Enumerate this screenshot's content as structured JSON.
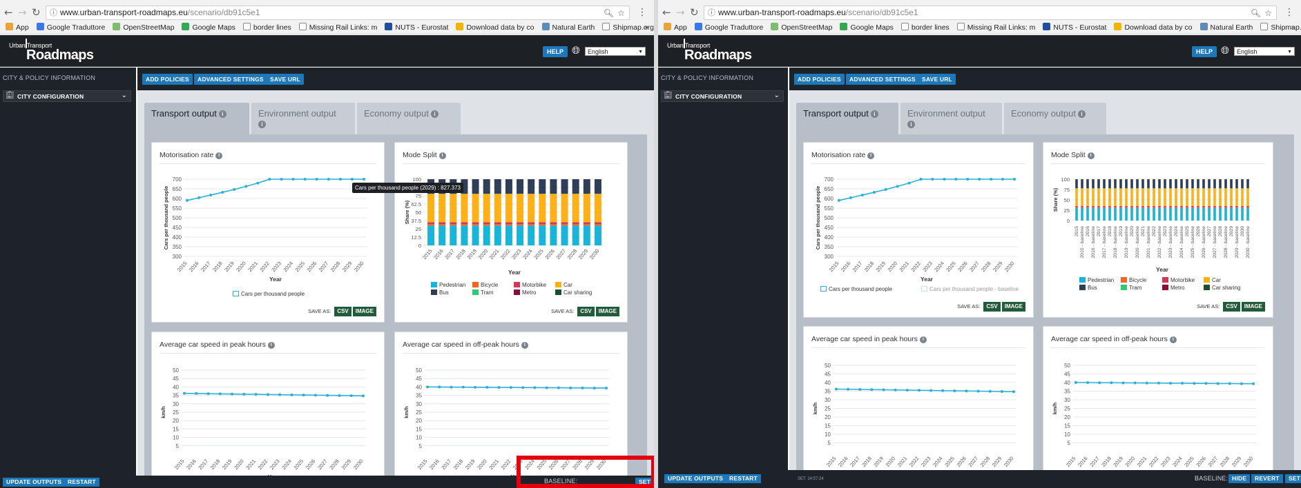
{
  "browser": {
    "url_host": "www.urban-transport-roadmaps.eu",
    "url_path": "/scenario/db91c5e1",
    "bookmarks": [
      {
        "label": "App",
        "color": "#e8a33a"
      },
      {
        "label": "Google Traduttore",
        "color": "#3b78e7"
      },
      {
        "label": "OpenStreetMap",
        "color": "#7ebc6f"
      },
      {
        "label": "Google Maps",
        "color": "#34a853"
      },
      {
        "label": "border lines",
        "color": "#ffffff"
      },
      {
        "label": "Missing Rail Links: m",
        "color": "#ffffff"
      },
      {
        "label": "NUTS - Eurostat",
        "color": "#1f4e9e"
      },
      {
        "label": "Download data by co",
        "color": "#f4b400"
      },
      {
        "label": "Natural Earth",
        "color": "#5b8db8"
      },
      {
        "label": "Shipmap.org | Visual",
        "color": "#ffffff"
      }
    ]
  },
  "app": {
    "logo_small": "Urban Transport",
    "logo_big": "Roadmaps",
    "help": "HELP",
    "language": "English"
  },
  "sidebar": {
    "title": "CITY & POLICY INFORMATION",
    "city_config": "CITY CONFIGURATION"
  },
  "toolbar": {
    "add_policies": "ADD POLICIES",
    "advanced_settings": "ADVANCED SETTINGS",
    "save_url": "SAVE URL"
  },
  "tabs": [
    {
      "label": "Transport output"
    },
    {
      "label": "Environment output"
    },
    {
      "label": "Economy output"
    }
  ],
  "cards": {
    "motorisation": "Motorisation rate",
    "mode_split": "Mode Split",
    "peak": "Average car speed in peak hours",
    "offpeak": "Average car speed in off-peak hours"
  },
  "save": {
    "label": "SAVE AS:",
    "csv": "CSV",
    "image": "IMAGE"
  },
  "tooltip": "Cars per thousand people (2029) : 827.373",
  "bottom": {
    "update": "UPDATE OUTPUTS",
    "restart": "RESTART",
    "baseline": "BASELINE:",
    "set": "SET",
    "hide": "HIDE",
    "revert": "REVERT",
    "stamp": "SET: 14:57:24"
  },
  "colors": {
    "series": "#2ab0d8",
    "pedestrian": "#19b4d8",
    "bicycle": "#f26522",
    "motorbike": "#d2375a",
    "car": "#fbb117",
    "bus": "#2f3e59",
    "tram": "#2ecc71",
    "metro": "#8b0a3c",
    "car_sharing": "#1b4d2e"
  },
  "chart_data": [
    {
      "id": "motorisation",
      "type": "line",
      "title": "Motorisation rate",
      "xlabel": "Year",
      "ylabel": "Cars per thousand people",
      "x": [
        "2015",
        "2016",
        "2017",
        "2018",
        "2019",
        "2020",
        "2021",
        "2022",
        "2023",
        "2024",
        "2025",
        "2026",
        "2027",
        "2028",
        "2029",
        "2030"
      ],
      "yticks": [
        300,
        350,
        400,
        450,
        500,
        550,
        600,
        650,
        700
      ],
      "ylim": [
        300,
        700
      ],
      "series": [
        {
          "name": "Cars per thousand people",
          "values": [
            590,
            604,
            618,
            632,
            647,
            663,
            680,
            700,
            700,
            700,
            700,
            700,
            700,
            700,
            700,
            700
          ]
        }
      ],
      "baseline_series_name": "Cars per thousand people - baseline"
    },
    {
      "id": "mode_split",
      "type": "bar",
      "stacked": true,
      "title": "Mode Split",
      "xlabel": "Year",
      "ylabel": "Share (%)",
      "x": [
        "2015",
        "2016",
        "2017",
        "2018",
        "2019",
        "2020",
        "2021",
        "2022",
        "2023",
        "2024",
        "2025",
        "2026",
        "2027",
        "2028",
        "2029",
        "2030"
      ],
      "yticks_left": [
        "0",
        "12.5",
        "25",
        "37.5",
        "50",
        "62.5",
        "75",
        "87.5",
        "100"
      ],
      "yticks_right": [
        "0",
        "25",
        "50",
        "75",
        "100"
      ],
      "right_x_labels": [
        "2015",
        "2015 - baseline",
        "2016",
        "2016 - baseline",
        "2017",
        "2017 - baseline",
        "2018",
        "2018 - baseline",
        "2019",
        "2019 - baseline",
        "2020",
        "2020 - baseline",
        "2021",
        "2021 - baseline",
        "2022",
        "2022 - baseline",
        "2023",
        "2023 - baseline",
        "2024",
        "2024 - baseline",
        "2025",
        "2025 - baseline",
        "2026",
        "2026 - baseline",
        "2027",
        "2027 - baseline",
        "2028",
        "2028 - baseline",
        "2029",
        "2029 - baseline",
        "2030",
        "2030 - baseline"
      ],
      "series": [
        {
          "name": "Pedestrian",
          "value": 30
        },
        {
          "name": "Bus",
          "value": 0
        },
        {
          "name": "Bicycle",
          "value": 2
        },
        {
          "name": "Tram",
          "value": 0
        },
        {
          "name": "Motorbike",
          "value": 3
        },
        {
          "name": "Metro",
          "value": 0
        },
        {
          "name": "Car",
          "value": 43
        },
        {
          "name": "Car sharing",
          "value": 0
        },
        {
          "name": "Bus_top",
          "value": 22
        }
      ]
    },
    {
      "id": "peak",
      "type": "line",
      "title": "Average car speed in peak hours",
      "xlabel": "Year",
      "ylabel": "km/h",
      "x": [
        "2015",
        "2016",
        "2017",
        "2018",
        "2019",
        "2020",
        "2021",
        "2022",
        "2023",
        "2024",
        "2025",
        "2026",
        "2027",
        "2028",
        "2029",
        "2030"
      ],
      "yticks": [
        5,
        10,
        15,
        20,
        25,
        30,
        35,
        40,
        45,
        50
      ],
      "ylim": [
        0,
        50
      ],
      "series": [
        {
          "name": "",
          "values": [
            36.2,
            36.1,
            36.0,
            35.9,
            35.8,
            35.7,
            35.6,
            35.5,
            35.4,
            35.3,
            35.2,
            35.1,
            35.0,
            34.9,
            34.8,
            34.7
          ]
        }
      ]
    },
    {
      "id": "offpeak",
      "type": "line",
      "title": "Average car speed in off-peak hours",
      "xlabel": "Year",
      "ylabel": "km/h",
      "x": [
        "2015",
        "2016",
        "2017",
        "2018",
        "2019",
        "2020",
        "2021",
        "2022",
        "2023",
        "2024",
        "2025",
        "2026",
        "2027",
        "2028",
        "2029",
        "2030"
      ],
      "yticks": [
        5,
        10,
        15,
        20,
        25,
        30,
        35,
        40,
        45,
        50
      ],
      "ylim": [
        0,
        50
      ],
      "series": [
        {
          "name": "",
          "values": [
            40.0,
            40.0,
            39.9,
            39.9,
            39.8,
            39.8,
            39.7,
            39.7,
            39.6,
            39.6,
            39.5,
            39.5,
            39.4,
            39.4,
            39.3,
            39.3
          ]
        }
      ]
    }
  ]
}
